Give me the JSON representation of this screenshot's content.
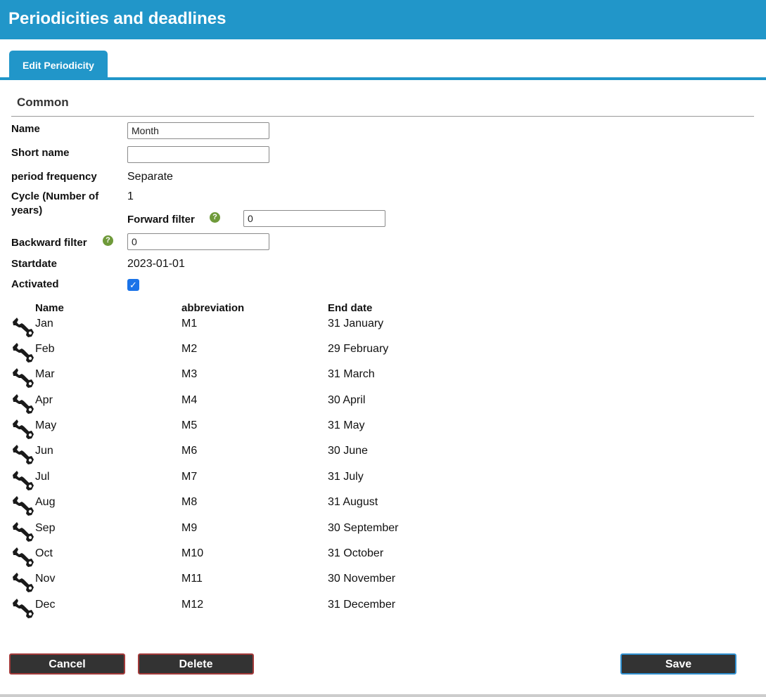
{
  "header": {
    "title": "Periodicities and deadlines"
  },
  "tabs": [
    {
      "label": "Edit Periodicity"
    }
  ],
  "section": {
    "title": "Common"
  },
  "form": {
    "name_label": "Name",
    "name_value": "Month",
    "short_name_label": "Short name",
    "short_name_value": "",
    "period_frequency_label": "period frequency",
    "period_frequency_value": "Separate",
    "cycle_label": "Cycle (Number of years)",
    "cycle_value": "1",
    "forward_filter_label": "Forward filter",
    "forward_filter_value": "0",
    "backward_filter_label": "Backward filter",
    "backward_filter_value": "0",
    "startdate_label": "Startdate",
    "startdate_value": "2023-01-01",
    "activated_label": "Activated",
    "activated": true,
    "help_icon": "question-mark"
  },
  "table": {
    "headers": {
      "name": "Name",
      "abbreviation": "abbreviation",
      "end_date": "End date"
    },
    "edit_icon": "wrench",
    "rows": [
      {
        "name": "Jan",
        "abbreviation": "M1",
        "end_date": "31 January"
      },
      {
        "name": "Feb",
        "abbreviation": "M2",
        "end_date": "29 February"
      },
      {
        "name": "Mar",
        "abbreviation": "M3",
        "end_date": "31 March"
      },
      {
        "name": "Apr",
        "abbreviation": "M4",
        "end_date": "30 April"
      },
      {
        "name": "May",
        "abbreviation": "M5",
        "end_date": "31 May"
      },
      {
        "name": "Jun",
        "abbreviation": "M6",
        "end_date": "30 June"
      },
      {
        "name": "Jul",
        "abbreviation": "M7",
        "end_date": "31 July"
      },
      {
        "name": "Aug",
        "abbreviation": "M8",
        "end_date": "31 August"
      },
      {
        "name": "Sep",
        "abbreviation": "M9",
        "end_date": "30 September"
      },
      {
        "name": "Oct",
        "abbreviation": "M10",
        "end_date": "31 October"
      },
      {
        "name": "Nov",
        "abbreviation": "M11",
        "end_date": "30 November"
      },
      {
        "name": "Dec",
        "abbreviation": "M12",
        "end_date": "31 December"
      }
    ]
  },
  "buttons": {
    "cancel": "Cancel",
    "delete": "Delete",
    "save": "Save"
  },
  "colors": {
    "primary": "#2196c9",
    "button_bg": "#333333",
    "help_green": "#6f9a3a",
    "checkbox_blue": "#1a73e8"
  }
}
